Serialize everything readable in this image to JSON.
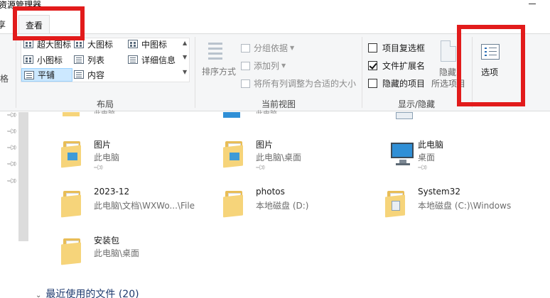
{
  "window": {
    "title": "资源管理器"
  },
  "tabs": {
    "share": "享",
    "view": "查看"
  },
  "ribbon": {
    "layout": {
      "label": "布局",
      "items": [
        "超大图标",
        "大图标",
        "中图标",
        "小图标",
        "列表",
        "详细信息",
        "平铺",
        "内容"
      ]
    },
    "current_view": {
      "label": "当前视图",
      "sort": "排序方式",
      "group_by": "分组依据",
      "add_column": "添加列",
      "fit_columns": "将所有列调整为合适的大小"
    },
    "show_hide": {
      "label": "显示/隐藏",
      "item_checkboxes": {
        "label": "项目复选框",
        "checked": false
      },
      "file_extensions": {
        "label": "文件扩展名",
        "checked": true
      },
      "hidden_items": {
        "label": "隐藏的项目",
        "checked": false
      },
      "hide": "隐藏",
      "hide_selected": "所选项目"
    },
    "options": "选项",
    "left_edge_label": "格"
  },
  "files": [
    {
      "name": "图片",
      "path": "此电脑",
      "icon": "pictures-folder-icon"
    },
    {
      "name": "图片",
      "path": "此电脑\\桌面",
      "icon": "pictures-folder-icon"
    },
    {
      "name": "此电脑",
      "path": "桌面",
      "icon": "computer-icon"
    },
    {
      "name": "2023-12",
      "path": "此电脑\\文档\\WXWo...\\File",
      "icon": "folder-icon"
    },
    {
      "name": "photos",
      "path": "本地磁盘 (D:)",
      "icon": "folder-icon"
    },
    {
      "name": "System32",
      "path": "本地磁盘 (C:)\\Windows",
      "icon": "folder-icon"
    },
    {
      "name": "安装包",
      "path": "此电脑\\桌面",
      "icon": "folder-icon"
    }
  ],
  "partial_top": {
    "path_a": "此电脑",
    "path_b": "此电脑"
  },
  "recent": {
    "label": "最近使用的文件 (20)"
  },
  "colors": {
    "highlight": "#e21b1b",
    "selected_tile": "#cce8ff",
    "folder": "#f6d47a"
  }
}
